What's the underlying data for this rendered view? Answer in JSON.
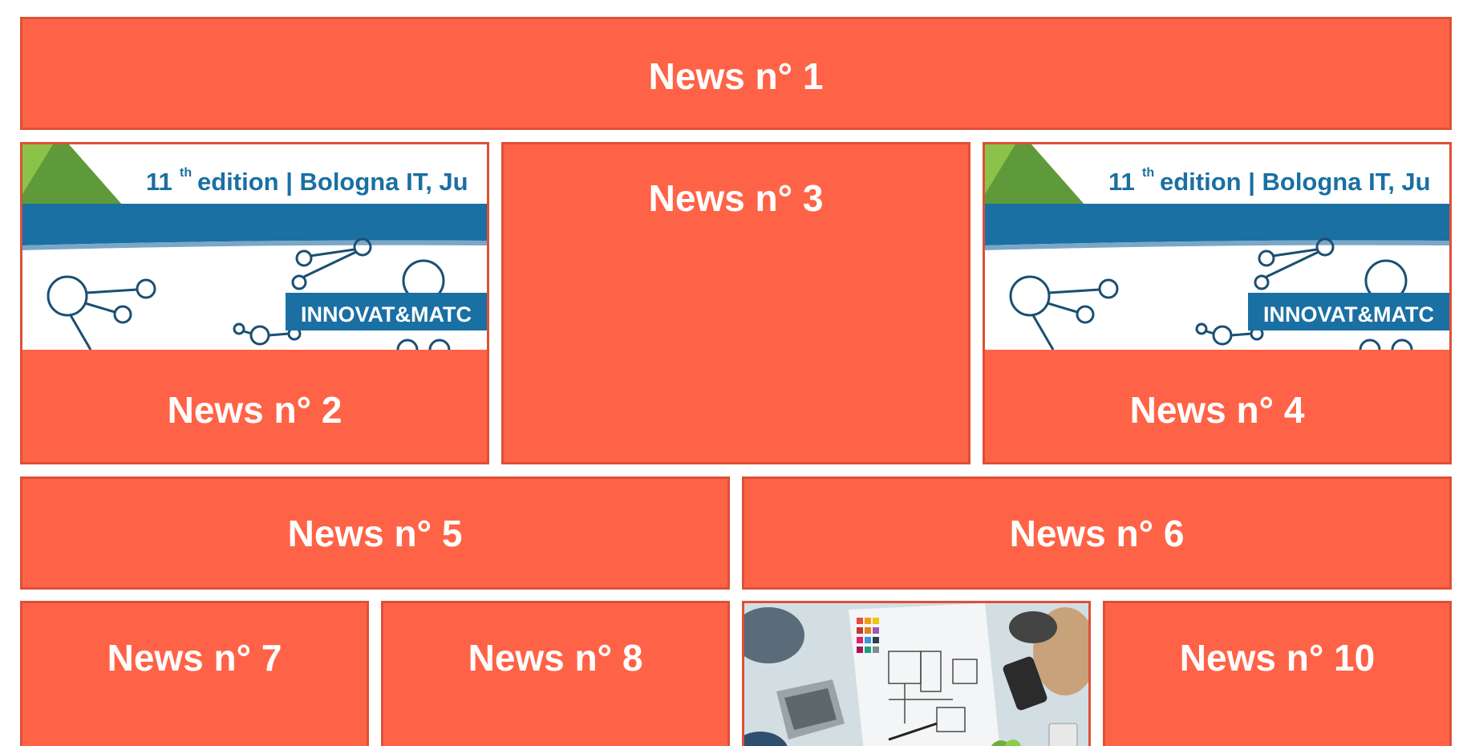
{
  "colors": {
    "tile_fill": "#ff6347",
    "tile_border": "#dd5036",
    "title_text": "#ffffff",
    "banner_blue": "#1a6fa3",
    "banner_green": "#5e9a3a",
    "banner_light_green": "#8bc34a"
  },
  "news": [
    {
      "title": "News n° 1",
      "image": null
    },
    {
      "title": "News n° 2",
      "image": "innovatmatch-banner"
    },
    {
      "title": "News n° 3",
      "image": null
    },
    {
      "title": "News n° 4",
      "image": "innovatmatch-banner"
    },
    {
      "title": "News n° 5",
      "image": null
    },
    {
      "title": "News n° 6",
      "image": null
    },
    {
      "title": "News n° 7",
      "image": null
    },
    {
      "title": "News n° 8",
      "image": null
    },
    {
      "title": "",
      "image": "team-meeting-photo"
    },
    {
      "title": "News n° 10",
      "image": null
    }
  ],
  "banner": {
    "edition_number": "11",
    "edition_suffix": "th",
    "edition_text": "edition | Bologna IT, Ju",
    "tag_text": "INNOVAT&MATC"
  }
}
